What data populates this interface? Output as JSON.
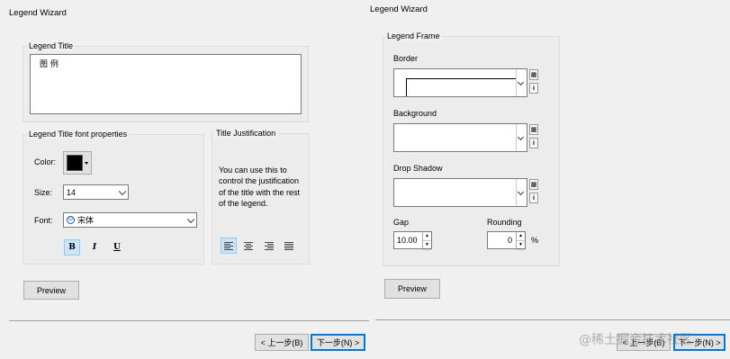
{
  "left": {
    "title": "Legend Wizard",
    "legend_title": {
      "group_label": "Legend Title",
      "value": "图 例"
    },
    "font_props": {
      "group_label": "Legend Title font properties",
      "color_label": "Color:",
      "color_value": "#000000",
      "size_label": "Size:",
      "size_value": "14",
      "font_label": "Font:",
      "font_value": "宋体",
      "bold": "B",
      "italic": "I",
      "underline": "U"
    },
    "justification": {
      "group_label": "Title Justification",
      "description": "You can use this to control the justification of the title with the rest of the legend."
    },
    "preview_label": "Preview",
    "back_label": "< 上一步(B)",
    "next_label": "下一步(N) >"
  },
  "right": {
    "title": "Legend Wizard",
    "frame": {
      "group_label": "Legend Frame",
      "border_label": "Border",
      "background_label": "Background",
      "shadow_label": "Drop Shadow",
      "gap_label": "Gap",
      "gap_value": "10.00",
      "rounding_label": "Rounding",
      "rounding_value": "0",
      "rounding_unit": "%"
    },
    "preview_label": "Preview",
    "back_label": "< 上一步(B)",
    "next_label": "下一步(N) >"
  },
  "watermark": "@稀土掘金技术社区"
}
